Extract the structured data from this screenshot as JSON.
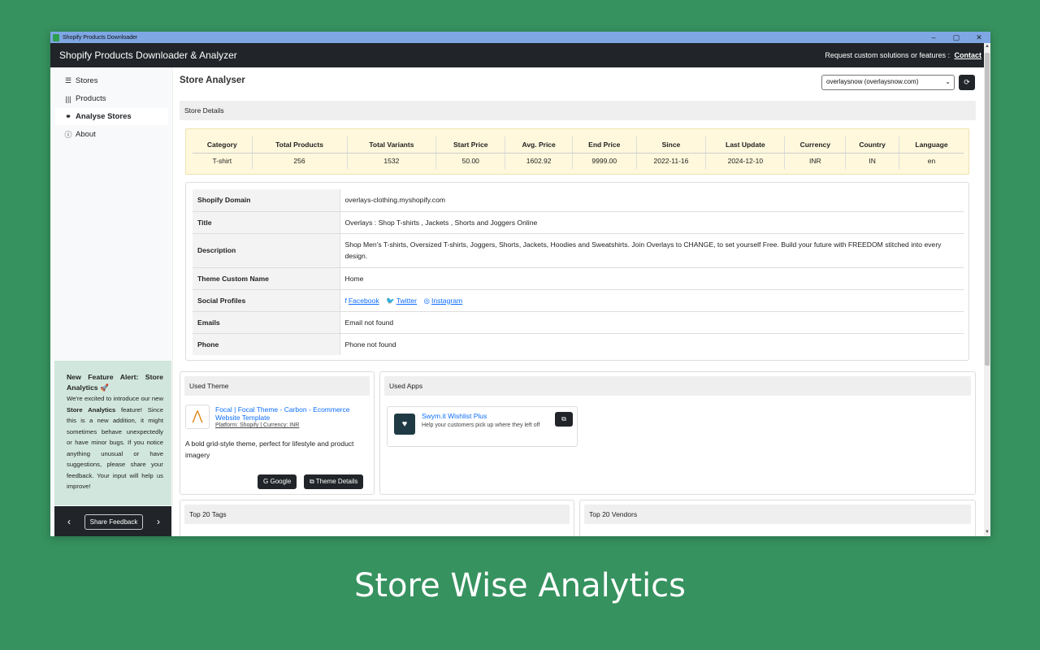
{
  "window": {
    "title": "Shopify Products Downloader",
    "minimize": "–",
    "maximize": "▢",
    "close": "✕"
  },
  "header": {
    "title": "Shopify Products Downloader & Analyzer",
    "request_text": "Request custom solutions or features :",
    "contact_label": "Contact"
  },
  "sidebar": {
    "items": [
      {
        "label": "Stores",
        "icon": "list-icon"
      },
      {
        "label": "Products",
        "icon": "barcode-icon"
      },
      {
        "label": "Analyse Stores",
        "icon": "binoculars-icon",
        "active": true
      },
      {
        "label": "About",
        "icon": "info-icon"
      }
    ],
    "alert": {
      "heading": "New Feature Alert: Store Analytics 🚀",
      "body_pre": "We're excited to introduce our new",
      "body_strong": "Store Analytics",
      "body_post": "feature! Since this is a new addition, it might sometimes behave unexpectedly or have minor bugs. If you notice anything unusual or have suggestions, please share your feedback. Your input will help us improve!"
    },
    "footer": {
      "prev": "‹",
      "feedback_label": "Share Feedback",
      "next": "›"
    }
  },
  "main": {
    "title": "Store Analyser",
    "store_select": "overlaysnow (overlaysnow.com)",
    "store_details_header": "Store Details",
    "stats": {
      "headers": [
        "Category",
        "Total Products",
        "Total Variants",
        "Start Price",
        "Avg. Price",
        "End Price",
        "Since",
        "Last Update",
        "Currency",
        "Country",
        "Language"
      ],
      "values": [
        "T-shirt",
        "256",
        "1532",
        "50.00",
        "1602.92",
        "9999.00",
        "2022-11-16",
        "2024-12-10",
        "INR",
        "IN",
        "en"
      ]
    },
    "details": {
      "domain_label": "Shopify Domain",
      "domain_value": "overlays-clothing.myshopify.com",
      "title_label": "Title",
      "title_value": "Overlays : Shop T-shirts , Jackets , Shorts and Joggers Online",
      "description_label": "Description",
      "description_value": "Shop Men's T-shirts, Oversized T-shirts, Joggers, Shorts, Jackets, Hoodies and Sweatshirts. Join Overlays to CHANGE, to set yourself Free. Build your future with FREEDOM stitched into every design.",
      "theme_name_label": "Theme Custom Name",
      "theme_name_value": "Home",
      "social_label": "Social Profiles",
      "facebook": "Facebook",
      "twitter": "Twitter",
      "instagram": "Instagram",
      "emails_label": "Emails",
      "emails_value": "Email not found",
      "phone_label": "Phone",
      "phone_value": "Phone not found"
    },
    "used_theme": {
      "header": "Used Theme",
      "name": "Focal | Focal Theme - Carbon - Ecommerce Website Template",
      "platform": "Platform: Shopify | Currency: INR",
      "description": "A bold grid-style theme, perfect for lifestyle and product imagery",
      "google_label": "Google",
      "details_label": "Theme Details"
    },
    "used_apps": {
      "header": "Used Apps",
      "app_name": "Swym.it Wishlist Plus",
      "app_desc": "Help your customers pick up where they left off"
    },
    "top_tags_header": "Top 20 Tags",
    "top_vendors_header": "Top 20 Vendors"
  },
  "caption": "Store Wise Analytics",
  "colors": {
    "background": "#36925f",
    "header": "#212529",
    "alert": "#d1e7dd",
    "stats_bg": "#fff8dc",
    "link": "#0d6efd"
  }
}
